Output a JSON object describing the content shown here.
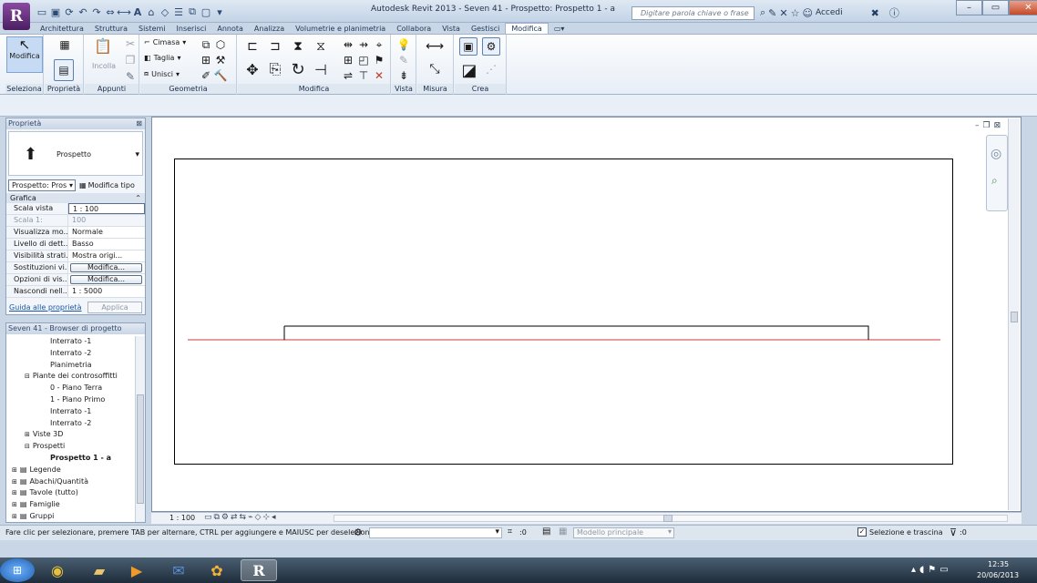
{
  "app": {
    "logo": "R",
    "title": "Autodesk Revit 2013 -    Seven 41 - Prospetto: Prospetto 1 - a",
    "search_placeholder": "Digitare parola chiave o frase",
    "accedi": "Accedi"
  },
  "tabs": [
    "Architettura",
    "Struttura",
    "Sistemi",
    "Inserisci",
    "Annota",
    "Analizza",
    "Volumetrie e planimetria",
    "Collabora",
    "Vista",
    "Gestisci",
    "Modifica"
  ],
  "active_tab": "Modifica",
  "ribbon": {
    "panels": [
      "Seleziona",
      "Proprietà",
      "Appunti",
      "Geometria",
      "Modifica",
      "Vista",
      "Misura",
      "Crea"
    ],
    "modifica_label": "Modifica",
    "incolla_label": "Incolla",
    "cimasa": "Cimasa",
    "taglia": "Taglia",
    "unisci": "Unisci"
  },
  "properties": {
    "header": "Proprietà",
    "type_name": "Prospetto",
    "selector_value": "Prospetto: Pros",
    "edit_type": "Modifica tipo",
    "group": "Grafica",
    "rows": [
      {
        "key": "Scala vista",
        "value": "1 : 100"
      },
      {
        "key": "Scala 1:",
        "value": "100"
      },
      {
        "key": "Visualizza mo...",
        "value": "Normale"
      },
      {
        "key": "Livello di dett...",
        "value": "Basso"
      },
      {
        "key": "Visibilità strati...",
        "value": "Mostra origi..."
      },
      {
        "key": "Sostituzioni vi...",
        "value": "Modifica..."
      },
      {
        "key": "Opzioni di vis...",
        "value": "Modifica..."
      },
      {
        "key": "Nascondi nell...",
        "value": "1 : 5000"
      }
    ],
    "help_link": "Guida alle proprietà",
    "apply": "Applica"
  },
  "browser": {
    "header": "Seven 41 - Browser di progetto",
    "items": [
      {
        "label": "Interrato -1",
        "level": 3
      },
      {
        "label": "Interrato -2",
        "level": 3
      },
      {
        "label": "Planimetria",
        "level": 3
      },
      {
        "label": "Piante dei controsoffitti",
        "level": 2
      },
      {
        "label": "0 - Piano Terra",
        "level": 3
      },
      {
        "label": "1 - Piano Primo",
        "level": 3
      },
      {
        "label": "Interrato -1",
        "level": 3
      },
      {
        "label": "Interrato -2",
        "level": 3
      },
      {
        "label": "Viste 3D",
        "level": 2
      },
      {
        "label": "Prospetti",
        "level": 2
      },
      {
        "label": "Prospetto 1 - a",
        "level": 3,
        "bold": true
      },
      {
        "label": "Legende",
        "level": 1
      },
      {
        "label": "Abachi/Quantità",
        "level": 1
      },
      {
        "label": "Tavole (tutto)",
        "level": 1
      },
      {
        "label": "Famiglie",
        "level": 1
      },
      {
        "label": "Gruppi",
        "level": 1
      }
    ]
  },
  "view_control": {
    "scale": "1 : 100"
  },
  "status": {
    "hint": "Fare clic per selezionare, premere TAB per alternare, CTRL per aggiungere e MAIUSC per deselezionar",
    "zero": ":0",
    "model": "Modello principale",
    "selection": "Selezione e trascina",
    "filter_count": ":0"
  },
  "taskbar": {
    "time": "12:35",
    "date": "20/06/2013"
  },
  "colors": {
    "ribbon_accent": "#5a7fb0",
    "level_line": "#d03b3b"
  }
}
